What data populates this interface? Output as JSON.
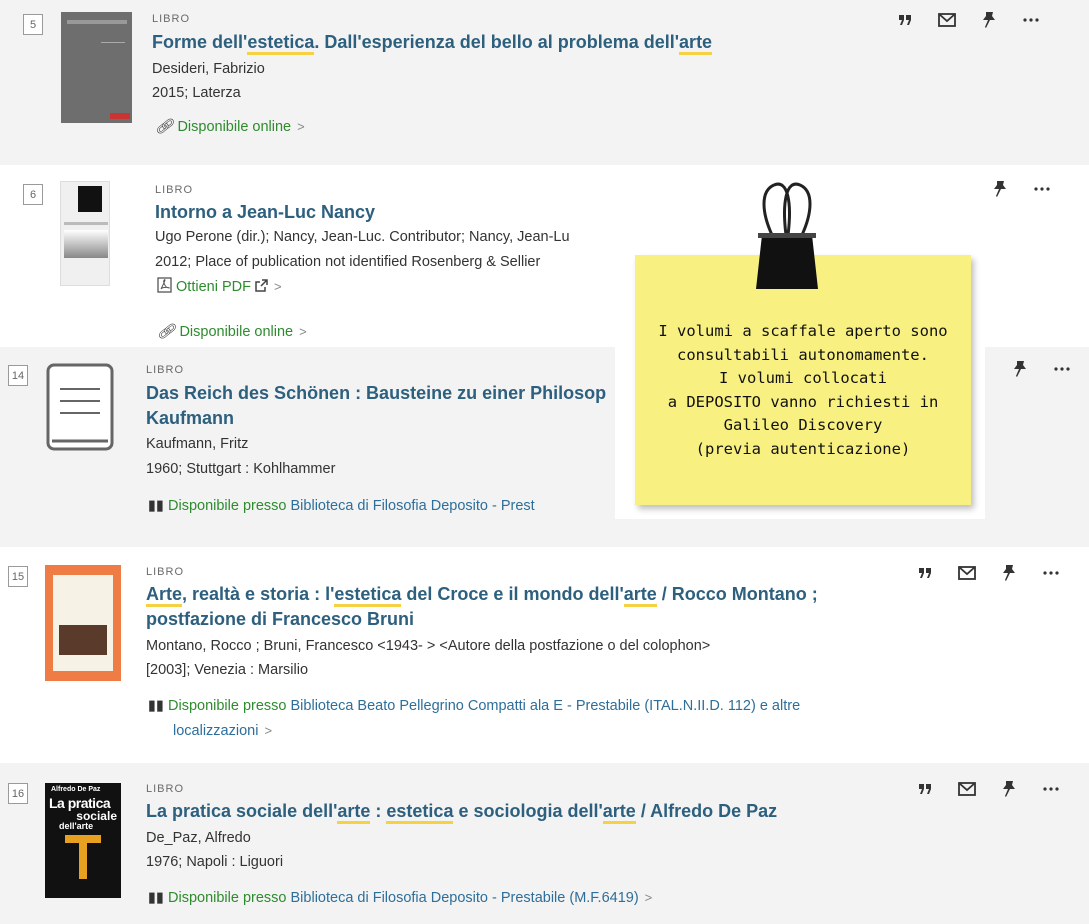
{
  "icons": {
    "cite": "quote-icon",
    "email": "envelope-icon",
    "pin": "pushpin-icon",
    "more": "ellipsis-icon",
    "online": "link-icon",
    "pdf": "pdf-icon",
    "external": "external-link-icon",
    "physical": "book-open-icon"
  },
  "colors": {
    "title": "#2d5f7e",
    "available": "#2e8b2e",
    "location": "#2d6e9a",
    "highlight": "#f5d243",
    "note": "#f8f081"
  },
  "records": [
    {
      "number": "5",
      "type": "LIBRO",
      "title_parts": [
        "Forme dell'",
        "estetica",
        ". Dall'esperienza del bello al problema dell'",
        "arte"
      ],
      "author": "Desideri, Fabrizio",
      "pub": "2015; Laterza",
      "online": "Disponibile online",
      "chev": ">"
    },
    {
      "number": "6",
      "type": "LIBRO",
      "title": "Intorno a Jean-Luc Nancy",
      "author": "Ugo Perone (dir.); Nancy, Jean-Luc. Contributor; Nancy, Jean-Lu",
      "pub": "2012; Place of publication not identified Rosenberg & Sellier",
      "pdf": "Ottieni PDF",
      "online": "Disponibile online",
      "chev": ">"
    },
    {
      "number": "14",
      "type": "LIBRO",
      "title_l1": "Das Reich des Schönen : Bausteine zu einer Philosop",
      "title_l2": "Kaufmann",
      "author": "Kaufmann, Fritz",
      "pub": "1960; Stuttgart : Kohlhammer",
      "avail_label": "Disponibile presso",
      "location": "Biblioteca di Filosofia  Deposito - Prest"
    },
    {
      "number": "15",
      "type": "LIBRO",
      "title_l1_parts": [
        "Arte",
        ", realtà e storia : l'",
        "estetica",
        " del Croce e il mondo dell'",
        "arte",
        " / Rocco Montano ;"
      ],
      "title_l2": "postfazione di Francesco Bruni",
      "author": "Montano, Rocco ; Bruni, Francesco <1943- > <Autore della postfazione o del colophon>",
      "pub": "[2003]; Venezia : Marsilio",
      "avail_label": "Disponibile presso",
      "location": "Biblioteca Beato Pellegrino  Compatti ala E - Prestabile (ITAL.N.II.D. 112) e altre",
      "location_l2": "localizzazioni",
      "chev": ">"
    },
    {
      "number": "16",
      "type": "LIBRO",
      "title_parts": [
        "La pratica sociale dell'",
        "arte",
        " : ",
        "estetica",
        " e sociologia dell'",
        "arte",
        " / Alfredo De Paz"
      ],
      "author": "De_Paz, Alfredo",
      "pub": "1976; Napoli : Liguori",
      "avail_label": "Disponibile presso",
      "location": "Biblioteca di Filosofia  Deposito - Prestabile (M.F.6419)",
      "chev": ">",
      "cover_text": [
        "Alfredo De Paz",
        "La pratica",
        "sociale",
        "dell'arte"
      ]
    }
  ],
  "note": {
    "lines": [
      "I volumi a scaffale aperto sono",
      "consultabili autonomamente.",
      "I volumi collocati",
      "a DEPOSITO vanno richiesti in",
      "Galileo Discovery",
      "(previa autenticazione)"
    ]
  }
}
